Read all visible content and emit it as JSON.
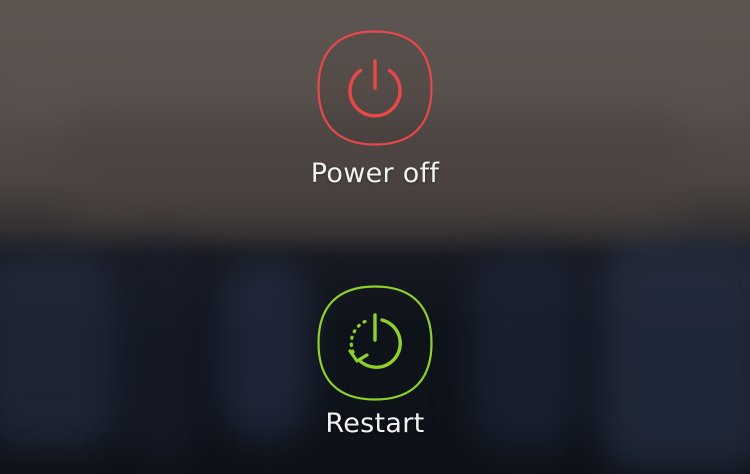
{
  "power_menu": {
    "items": [
      {
        "id": "power-off",
        "label": "Power off",
        "icon": "power-icon",
        "color": "#e8484a"
      },
      {
        "id": "restart",
        "label": "Restart",
        "icon": "restart-icon",
        "color": "#8ed12a"
      }
    ]
  }
}
